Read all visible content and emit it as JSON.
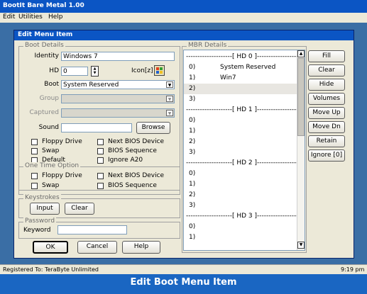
{
  "app_title": "BootIt Bare Metal 1.00",
  "menu": [
    "Edit",
    "Utilities",
    "Help"
  ],
  "dialog_title": "Edit Menu Item",
  "boot_details": {
    "title": "Boot Details",
    "identity_label": "Identity",
    "identity_value": "Windows 7",
    "hd_label": "HD",
    "hd_value": "0",
    "icon_label": "Icon[z]",
    "boot_label": "Boot",
    "boot_value": "System Reserved",
    "group_label": "Group",
    "captured_label": "Captured",
    "sound_label": "Sound",
    "browse_label": "Browse",
    "checks": [
      "Floppy Drive",
      "Next BIOS Device",
      "Swap",
      "BIOS Sequence",
      "Default",
      "Ignore A20"
    ]
  },
  "one_time": {
    "title": "One Time Option",
    "checks": [
      "Floppy Drive",
      "Next BIOS Device",
      "Swap",
      "BIOS Sequence"
    ]
  },
  "keystrokes": {
    "title": "Keystrokes",
    "input_label": "Input",
    "clear_label": "Clear"
  },
  "password": {
    "title": "Password",
    "keyword_label": "Keyword"
  },
  "footer_buttons": {
    "ok": "OK",
    "cancel": "Cancel",
    "help": "Help"
  },
  "mbr": {
    "title": "MBR Details",
    "rows": [
      {
        "n": "",
        "t": "--------------------[ HD 0 ]--------------------"
      },
      {
        "n": "0)",
        "t": "System Reserved"
      },
      {
        "n": "1)",
        "t": "Win7"
      },
      {
        "n": "2)",
        "t": ""
      },
      {
        "n": "3)",
        "t": ""
      },
      {
        "n": "",
        "t": "--------------------[ HD 1 ]--------------------"
      },
      {
        "n": "0)",
        "t": ""
      },
      {
        "n": "1)",
        "t": ""
      },
      {
        "n": "2)",
        "t": ""
      },
      {
        "n": "3)",
        "t": ""
      },
      {
        "n": "",
        "t": "--------------------[ HD 2 ]--------------------"
      },
      {
        "n": "0)",
        "t": ""
      },
      {
        "n": "1)",
        "t": ""
      },
      {
        "n": "2)",
        "t": ""
      },
      {
        "n": "3)",
        "t": ""
      },
      {
        "n": "",
        "t": "--------------------[ HD 3 ]--------------------"
      },
      {
        "n": "0)",
        "t": ""
      },
      {
        "n": "1)",
        "t": ""
      }
    ]
  },
  "side_buttons": [
    "Fill",
    "Clear",
    "Hide",
    "Volumes",
    "Move Up",
    "Move Dn",
    "Retain",
    "Ignore [0]"
  ],
  "status": {
    "left": "Registered To: TeraByte Unlimited",
    "time": "9:19 pm"
  },
  "banner": "Edit Boot Menu Item",
  "colors": {
    "title_bar": "#0b55c4",
    "desktop": "#3a6ea5",
    "dialog_bg": "#ece9d8",
    "banner": "#1a66c2"
  }
}
